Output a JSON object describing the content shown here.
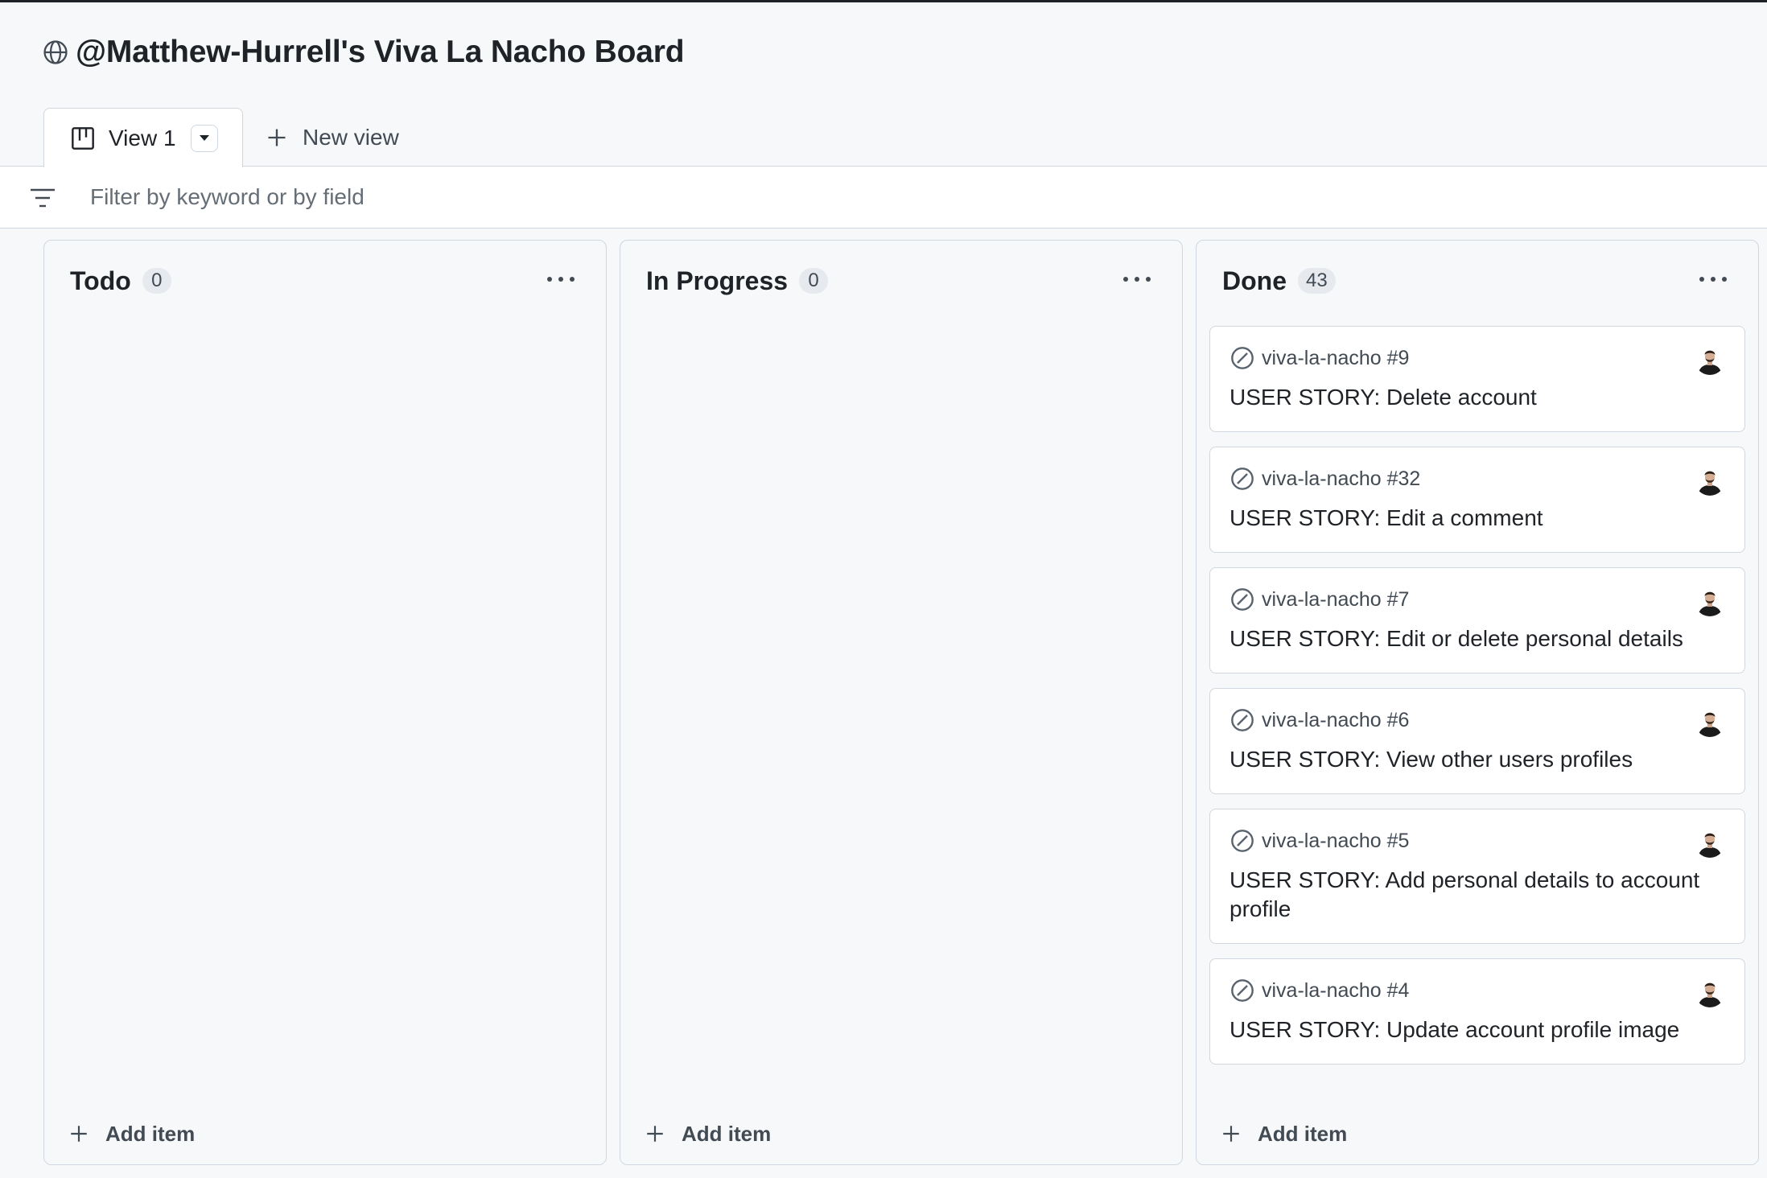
{
  "header": {
    "title": "@Matthew-Hurrell's Viva La Nacho Board",
    "icon": "globe-icon"
  },
  "tabs": {
    "active_label": "View 1",
    "new_view_label": "New view"
  },
  "filter": {
    "placeholder": "Filter by keyword or by field"
  },
  "columns": [
    {
      "name": "Todo",
      "count": "0",
      "add_label": "Add item"
    },
    {
      "name": "In Progress",
      "count": "0",
      "add_label": "Add item"
    },
    {
      "name": "Done",
      "count": "43",
      "add_label": "Add item",
      "cards": [
        {
          "repo": "viva-la-nacho #9",
          "title": "USER STORY: Delete account"
        },
        {
          "repo": "viva-la-nacho #32",
          "title": "USER STORY: Edit a comment"
        },
        {
          "repo": "viva-la-nacho #7",
          "title": "USER STORY: Edit or delete personal details"
        },
        {
          "repo": "viva-la-nacho #6",
          "title": "USER STORY: View other users profiles"
        },
        {
          "repo": "viva-la-nacho #5",
          "title": "USER STORY: Add personal details to account profile"
        },
        {
          "repo": "viva-la-nacho #4",
          "title": "USER STORY: Update account profile image"
        }
      ]
    }
  ],
  "colors": {
    "background": "#f6f8fa",
    "border": "#d0d7de",
    "text": "#1f2328",
    "muted": "#424a53"
  }
}
